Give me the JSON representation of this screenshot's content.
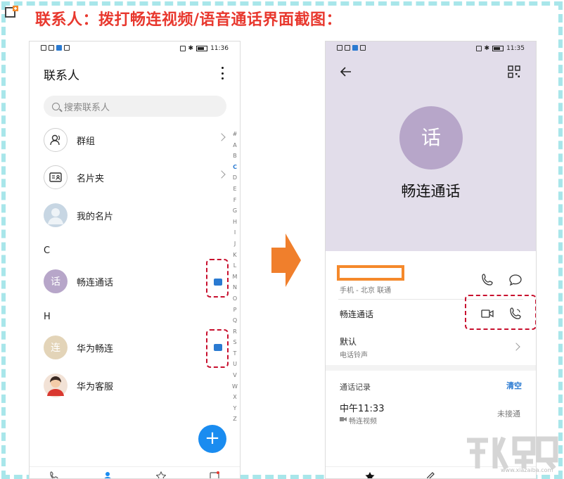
{
  "headline": "联系人：拨打畅连视频/语音通话界面截图：",
  "phone1": {
    "status_time": "11:36",
    "title": "联系人",
    "search_placeholder": "搜索联系人",
    "rows": [
      {
        "label": "群组"
      },
      {
        "label": "名片夹"
      },
      {
        "label": "我的名片"
      }
    ],
    "section_c": "C",
    "contact_c": {
      "avatar_text": "话",
      "name": "畅连通话"
    },
    "section_h": "H",
    "contact_h": {
      "avatar_text": "连",
      "name": "华为畅连"
    },
    "contact_h2": {
      "name": "华为客服"
    },
    "index_letters": [
      "#",
      "A",
      "B",
      "C",
      "D",
      "E",
      "F",
      "G",
      "H",
      "I",
      "J",
      "K",
      "L",
      "M",
      "N",
      "O",
      "P",
      "Q",
      "R",
      "S",
      "T",
      "U",
      "V",
      "W",
      "X",
      "Y",
      "Z"
    ],
    "fab_symbol": "+"
  },
  "phone2": {
    "status_time": "11:35",
    "avatar_text": "话",
    "name": "畅连通话",
    "number_sub": "手机 - 北京 联通",
    "changlian_label": "畅连通话",
    "ringtone_label": "默认",
    "ringtone_sub": "电话铃声",
    "call_log_title": "通话记录",
    "clear_label": "清空",
    "log_time": "中午11:33",
    "log_type": "畅连视频",
    "log_status": "未接通"
  },
  "watermark_url": "www.xiazaiba.com",
  "colors": {
    "headline": "#e8382e",
    "frame": "#a8e6ea",
    "accent_blue": "#2a7ad1",
    "header_lavender": "#e2ddea",
    "avatar_purple": "#b7a6c9",
    "highlight_red": "#c8102e",
    "highlight_orange": "#f5892b",
    "arrow_orange": "#f07f2c"
  }
}
